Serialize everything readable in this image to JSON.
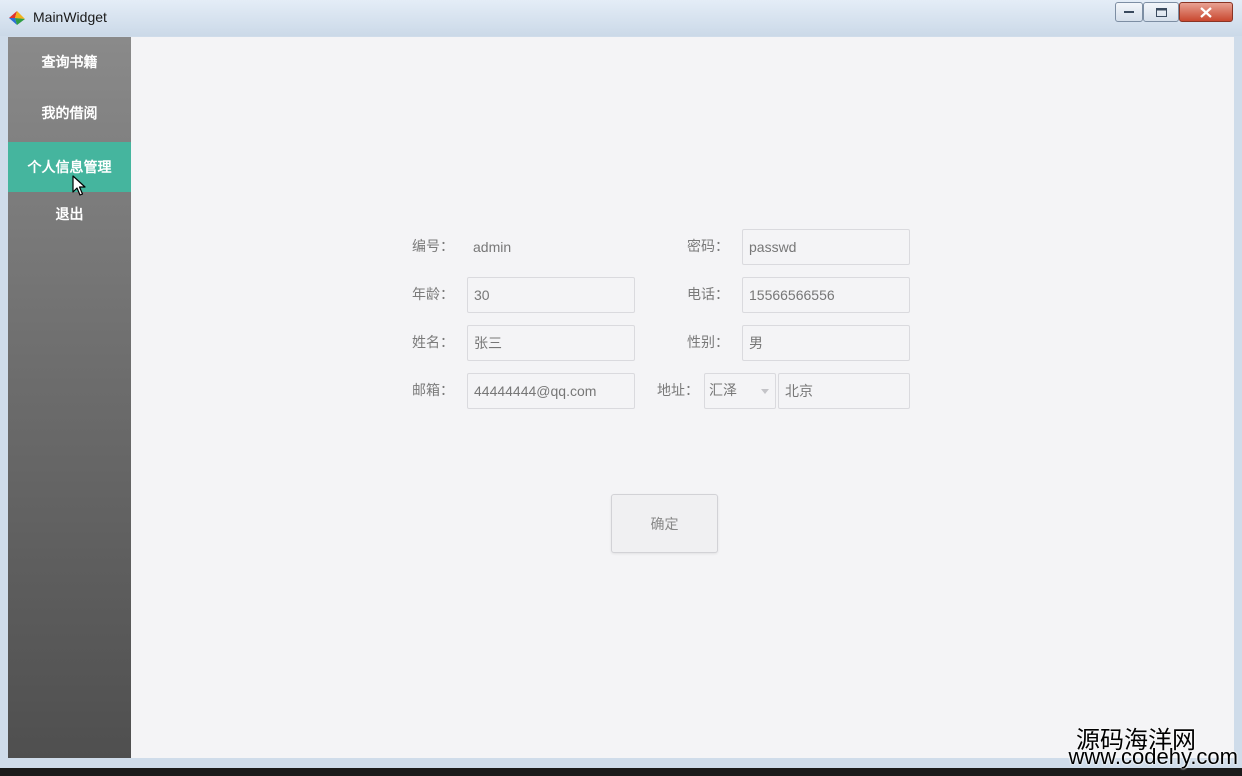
{
  "window": {
    "title": "MainWidget"
  },
  "sidebar": {
    "items": [
      {
        "label": "查询书籍"
      },
      {
        "label": "我的借阅"
      },
      {
        "label": "个人信息管理"
      },
      {
        "label": "退出"
      }
    ],
    "active_index": 2
  },
  "form": {
    "id_label": "编号：",
    "id_value": "admin",
    "password_label": "密码：",
    "password_value": "passwd",
    "age_label": "年龄：",
    "age_value": "30",
    "phone_label": "电话：",
    "phone_value": "15566566556",
    "name_label": "姓名：",
    "name_value": "张三",
    "gender_label": "性别：",
    "gender_value": "男",
    "email_label": "邮箱：",
    "email_value": "44444444@qq.com",
    "address_label": "地址：",
    "address_city": "汇泽",
    "address_detail": "北京",
    "confirm_label": "确定"
  },
  "watermark": {
    "line1": "源码海洋网",
    "line2": "www.codehy.com"
  },
  "colors": {
    "sidebar_active": "#45b59e",
    "close_button": "#c9482f"
  }
}
